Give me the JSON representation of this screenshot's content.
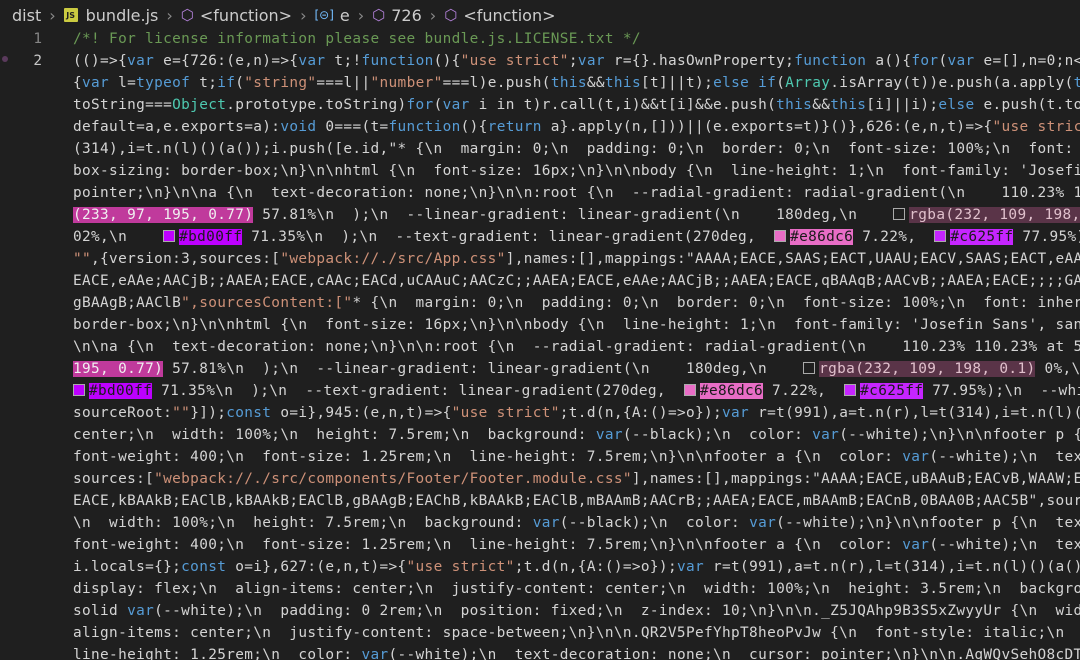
{
  "breadcrumb": {
    "folder": "dist",
    "file": "bundle.js",
    "file_icon_text": "JS",
    "crumbs": [
      "<function>",
      "e",
      "726",
      "<function>"
    ]
  },
  "editor": {
    "line_numbers": [
      "1",
      "2"
    ],
    "lines": [
      "/*! For license information please see bundle.js.LICENSE.txt */",
      "(()=>{var e={726:(e,n)=>{var t;!function(){\"use strict\";var r={}.hasOwnProperty;function a(){for(var e=[],n=0;n<arg",
      "{var l=typeof t;if(\"string\"===l||\"number\"===l)e.push(this&&this[t]||t);else if(Array.isArray(t))e.push(a.apply(this",
      "toString===Object.prototype.toString)for(var i in t)r.call(t,i)&&t[i]&&e.push(this&&this[i]||i);else e.push(t.toStr",
      "default=a,e.exports=a):void 0===(t=function(){return a}.apply(n,[]))||(e.exports=t)}()},626:(e,n,t)=>{\"use strict\";",
      "(314),i=t.n(l)()(a());i.push([e.id,\"* {\\n  margin: 0;\\n  padding: 0;\\n  border: 0;\\n  font-size: 100%;\\n  font: inh",
      "box-sizing: border-box;\\n}\\n\\nhtml {\\n  font-size: 16px;\\n}\\n\\nbody {\\n  line-height: 1;\\n  font-family: 'Josefin S",
      "pointer;\\n}\\n\\na {\\n  text-decoration: none;\\n}\\n\\n:root {\\n  --radial-gradient: radial-gradient(\\n    110.23% 110.",
      "(233, 97, 195, 0.77) 57.81%\\n  );\\n  --linear-gradient: linear-gradient(\\n    180deg,\\n    rgba(232, 109, 198, 0.",
      "02%,\\n    #bd00ff 71.35%\\n  );\\n  --text-gradient: linear-gradient(270deg,  #e86dc6 7.22%,  #c625ff 77.95%);\\n",
      "\"\",{version:3,sources:[\"webpack://./src/App.css\"],names:[],mappings:\"AAAA;EACE,SAAS;EACT,UAAU;EACV,SAAS;EACT,eAAe;E",
      "EACE,eAAe;AACjB;;AAEA;EACE,cAAc;EACd,uCAAuC;AACzC;;AAEA;EACE,eAAe;AACjB;;AAEA;EACE,qBAAqB;AACvB;;AAEA;EACE;;;;GAIC;",
      "gBAAgB;AAClB\",sourcesContent:[\"* {\\n  margin: 0;\\n  padding: 0;\\n  border: 0;\\n  font-size: 100%;\\n  font: inherit;",
      "border-box;\\n}\\n\\nhtml {\\n  font-size: 16px;\\n}\\n\\nbody {\\n  line-height: 1;\\n  font-family: 'Josefin Sans', sans-s",
      "\\n\\na {\\n  text-decoration: none;\\n}\\n\\n:root {\\n  --radial-gradient: radial-gradient(\\n    110.23% 110.23% at 50%",
      "195, 0.77) 57.81%\\n  );\\n  --linear-gradient: linear-gradient(\\n    180deg,\\n    rgba(232, 109, 198, 0.1) 0%,\\n",
      "#bd00ff 71.35%\\n  );\\n  --text-gradient: linear-gradient(270deg,  #e86dc6 7.22%,  #c625ff 77.95%);\\n  --white:",
      "sourceRoot:\"\"}]);const o=i},945:(e,n,t)=>{\"use strict\";t.d(n,{A:()=>o});var r=t(991),a=t.n(r),l=t(314),i=t.n(l)()(a",
      "center;\\n  width: 100%;\\n  height: 7.5rem;\\n  background: var(--black);\\n  color: var(--white);\\n}\\n\\nfooter p {\\n",
      "font-weight: 400;\\n  font-size: 1.25rem;\\n  line-height: 7.5rem;\\n}\\n\\nfooter a {\\n  color: var(--white);\\n  text-d",
      "sources:[\"webpack://./src/components/Footer/Footer.module.css\"],names:[],mappings:\"AAAA;EACE,uBAAuB;EACvB,WAAW;EACX",
      "EACE,kBAAkB;EAClB,kBAAkB;EAClB,gBAAgB;EAChB,kBAAkB;EAClB,mBAAmB;AACrB;;AAEA;EACE,mBAAmB;EACnB,0BAA0B;AAC5B\",sources",
      "\\n  width: 100%;\\n  height: 7.5rem;\\n  background: var(--black);\\n  color: var(--white);\\n}\\n\\nfooter p {\\n  text-a",
      "font-weight: 400;\\n  font-size: 1.25rem;\\n  line-height: 7.5rem;\\n}\\n\\nfooter a {\\n  color: var(--white);\\n  text-d",
      "i.locals={};const o=i},627:(e,n,t)=>{\"use strict\";t.d(n,{A:()=>o});var r=t(991),a=t.n(r),l=t(314),i=t.n(l)()(a());i",
      "display: flex;\\n  align-items: center;\\n  justify-content: center;\\n  width: 100%;\\n  height: 3.5rem;\\n  backgroun",
      "solid var(--white);\\n  padding: 0 2rem;\\n  position: fixed;\\n  z-index: 10;\\n}\\n\\n._Z5JQAhp9B3S5xZwyyUr {\\n  width:",
      "align-items: center;\\n  justify-content: space-between;\\n}\\n\\n.QR2V5PefYhpT8heoPvJw {\\n  font-style: italic;\\n  fon",
      "line-height: 1.25rem;\\n  color: var(--white);\\n  text-decoration: none;\\n  cursor: pointer;\\n}\\n\\n.AqWQvSehO8cDTO_l"
    ]
  },
  "colors": {
    "background": "#1f1f1f",
    "comment": "#6a9955",
    "swatch_pink": "#e961c3",
    "swatch_magenta": "#bd00ff",
    "swatch_e86dc6": "#e86dc6",
    "swatch_c625ff": "#c625ff"
  }
}
